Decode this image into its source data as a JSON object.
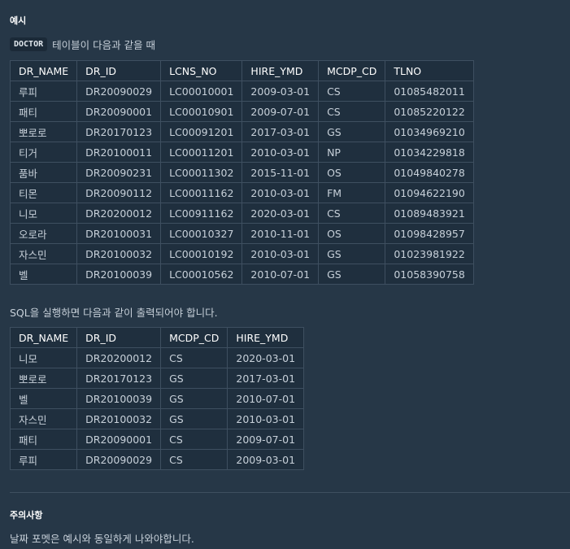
{
  "example": {
    "title": "예시",
    "table_name": "DOCTOR",
    "intro_text": "테이블이 다음과 같을 때"
  },
  "doctor_table": {
    "columns": [
      "DR_NAME",
      "DR_ID",
      "LCNS_NO",
      "HIRE_YMD",
      "MCDP_CD",
      "TLNO"
    ],
    "rows": [
      [
        "루피",
        "DR20090029",
        "LC00010001",
        "2009-03-01",
        "CS",
        "01085482011"
      ],
      [
        "패티",
        "DR20090001",
        "LC00010901",
        "2009-07-01",
        "CS",
        "01085220122"
      ],
      [
        "뽀로로",
        "DR20170123",
        "LC00091201",
        "2017-03-01",
        "GS",
        "01034969210"
      ],
      [
        "티거",
        "DR20100011",
        "LC00011201",
        "2010-03-01",
        "NP",
        "01034229818"
      ],
      [
        "품바",
        "DR20090231",
        "LC00011302",
        "2015-11-01",
        "OS",
        "01049840278"
      ],
      [
        "티몬",
        "DR20090112",
        "LC00011162",
        "2010-03-01",
        "FM",
        "01094622190"
      ],
      [
        "니모",
        "DR20200012",
        "LC00911162",
        "2020-03-01",
        "CS",
        "01089483921"
      ],
      [
        "오로라",
        "DR20100031",
        "LC00010327",
        "2010-11-01",
        "OS",
        "01098428957"
      ],
      [
        "자스민",
        "DR20100032",
        "LC00010192",
        "2010-03-01",
        "GS",
        "01023981922"
      ],
      [
        "벨",
        "DR20100039",
        "LC00010562",
        "2010-07-01",
        "GS",
        "01058390758"
      ]
    ]
  },
  "sql_note": "SQL을 실행하면 다음과 같이 출력되어야 합니다.",
  "result_table": {
    "columns": [
      "DR_NAME",
      "DR_ID",
      "MCDP_CD",
      "HIRE_YMD"
    ],
    "rows": [
      [
        "니모",
        "DR20200012",
        "CS",
        "2020-03-01"
      ],
      [
        "뽀로로",
        "DR20170123",
        "GS",
        "2017-03-01"
      ],
      [
        "벨",
        "DR20100039",
        "GS",
        "2010-07-01"
      ],
      [
        "자스민",
        "DR20100032",
        "GS",
        "2010-03-01"
      ],
      [
        "패티",
        "DR20090001",
        "CS",
        "2009-07-01"
      ],
      [
        "루피",
        "DR20090029",
        "CS",
        "2009-03-01"
      ]
    ]
  },
  "caution": {
    "title": "주의사항",
    "text": "날짜 포멧은 예시와 동일하게 나와야합니다."
  },
  "colors": {
    "background": "#263747",
    "table_cell": "#1f2f3e",
    "border": "#3e4f60"
  }
}
